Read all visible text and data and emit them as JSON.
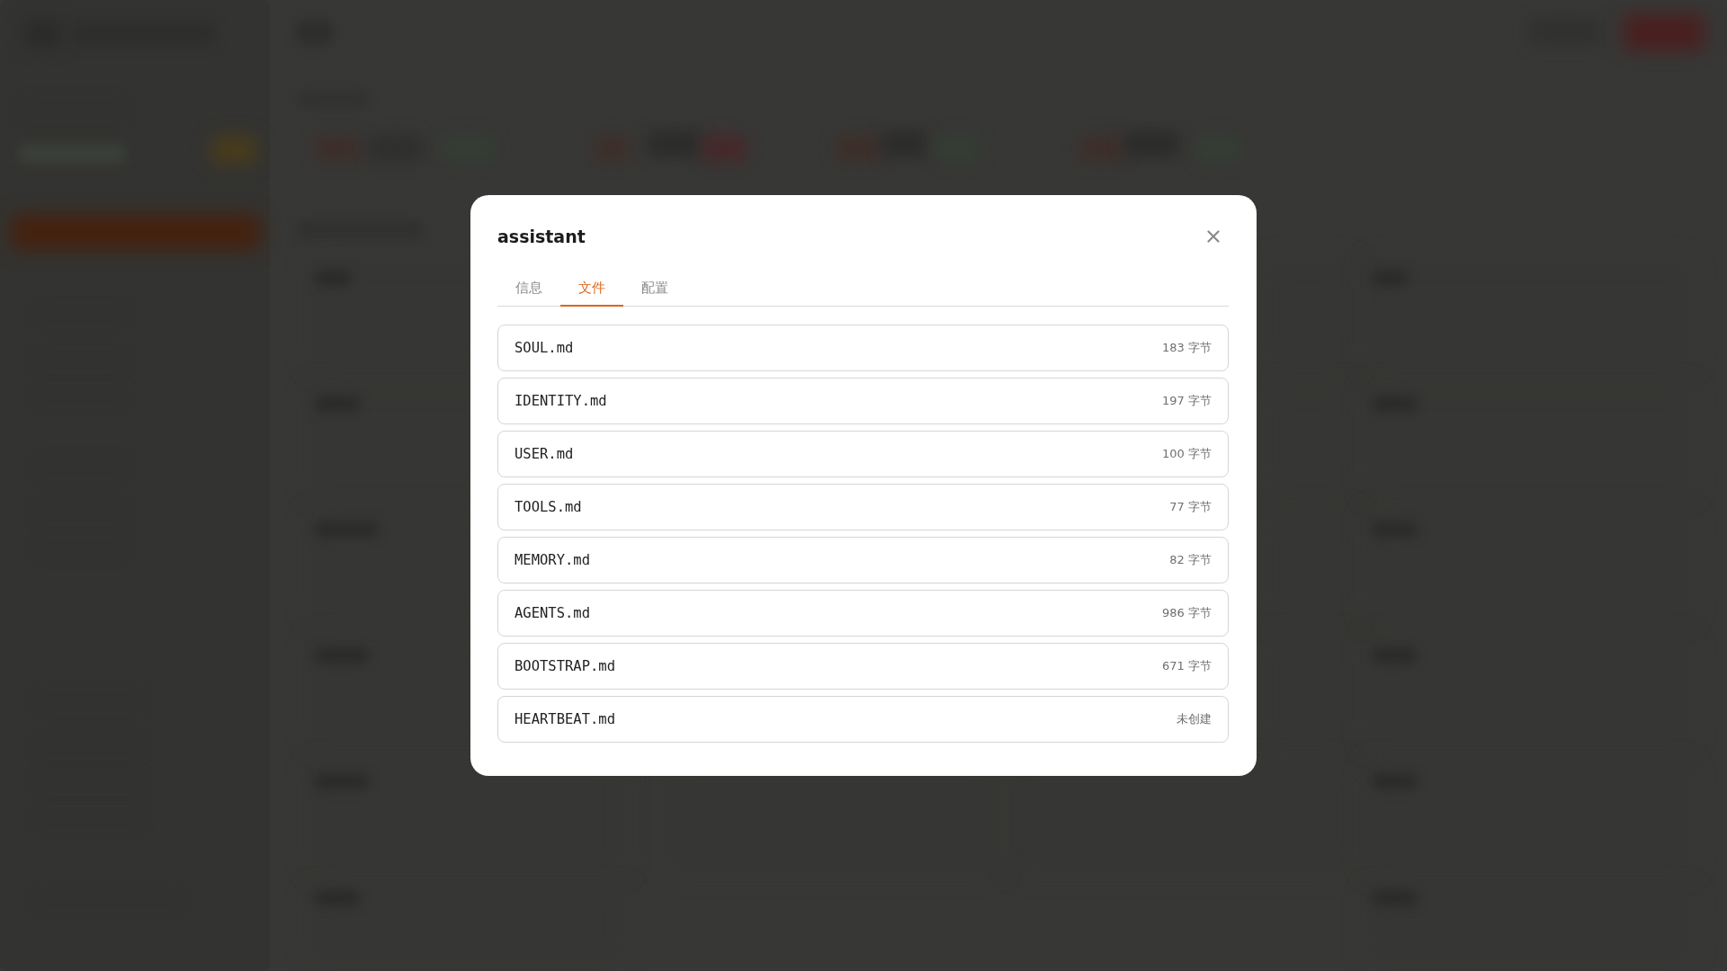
{
  "dialog": {
    "title": "assistant",
    "tabs": [
      {
        "label": "信息",
        "selected": false
      },
      {
        "label": "文件",
        "selected": true
      },
      {
        "label": "配置",
        "selected": false
      }
    ],
    "files": [
      {
        "name": "SOUL.md",
        "detail": "183 字节"
      },
      {
        "name": "IDENTITY.md",
        "detail": "197 字节"
      },
      {
        "name": "USER.md",
        "detail": "100 字节"
      },
      {
        "name": "TOOLS.md",
        "detail": "77 字节"
      },
      {
        "name": "MEMORY.md",
        "detail": "82 字节"
      },
      {
        "name": "AGENTS.md",
        "detail": "986 字节"
      },
      {
        "name": "BOOTSTRAP.md",
        "detail": "671 字节"
      },
      {
        "name": "HEARTBEAT.md",
        "detail": "未创建"
      }
    ]
  }
}
